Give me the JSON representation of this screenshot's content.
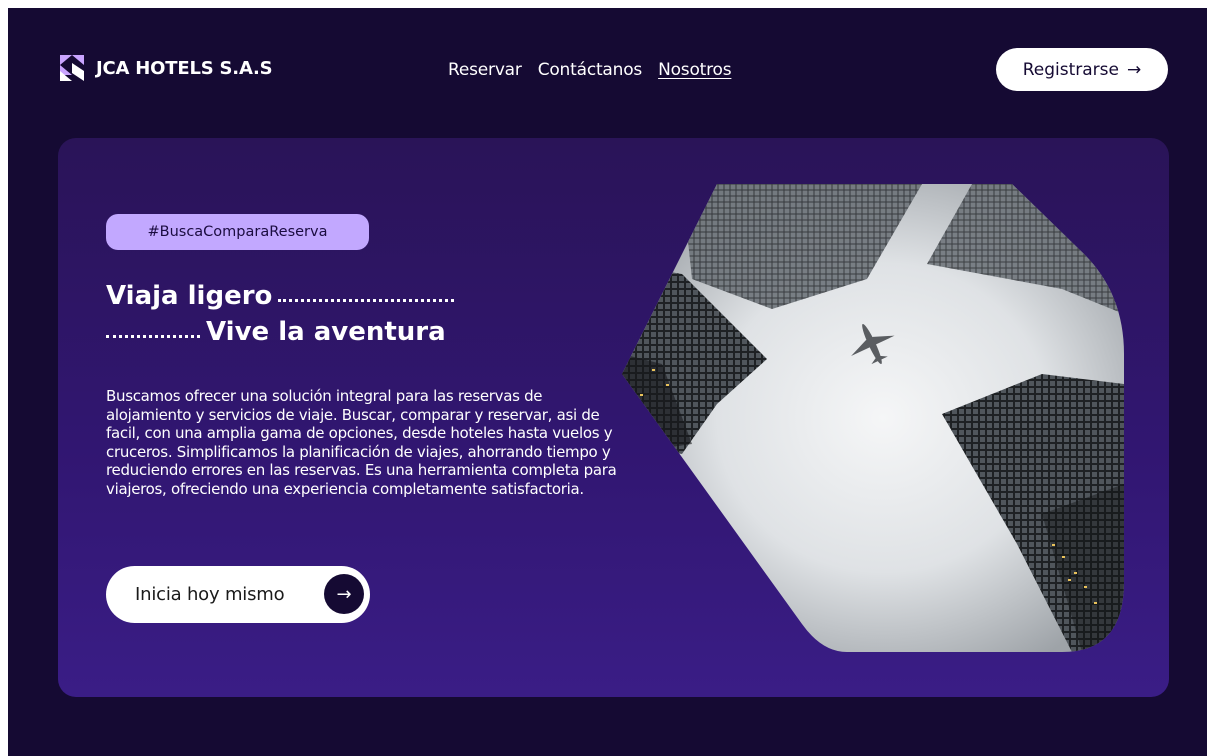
{
  "header": {
    "brand": "JCA HOTELS S.A.S",
    "logo_icon": "geometric-logo-icon",
    "nav": [
      {
        "label": "Reservar",
        "active": false
      },
      {
        "label": "Contáctanos",
        "active": false
      },
      {
        "label": "Nosotros",
        "active": true
      }
    ],
    "register_label": "Registrarse",
    "register_arrow": "→"
  },
  "hero": {
    "tag": "#BuscaComparaReserva",
    "headline_line1": "Viaja ligero",
    "headline_line2": "Vive la aventura",
    "description": "Buscamos ofrecer una solución integral para las reservas de alojamiento y servicios de viaje. Buscar, comparar y reservar, asi de facil, con una amplia gama de opciones, desde hoteles hasta vuelos y cruceros. Simplificamos la planificación de viajes, ahorrando tiempo y reduciendo errores en las reservas. Es una herramienta completa para viajeros, ofreciendo una experiencia completamente satisfactoria.",
    "cta_label": "Inicia hoy mismo",
    "cta_arrow": "→",
    "image_icon": "skyscrapers-airplane-photo"
  },
  "colors": {
    "page_bg": "#150a33",
    "hero_bg": "#311671",
    "tag_bg": "#c2a8ff",
    "logo_accent": "#c9a4ff",
    "text": "#ffffff"
  }
}
